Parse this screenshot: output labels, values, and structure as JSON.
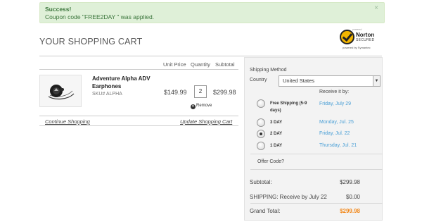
{
  "alert": {
    "heading": "Success!",
    "message": "Coupon code \"FREE2DAY \" was applied.",
    "close": "×",
    "color": "#dff0d8"
  },
  "cart": {
    "title": "YOUR SHOPPING CART",
    "headers": {
      "unit_price": "Unit Price",
      "quantity": "Quantity",
      "subtotal": "Subtotal"
    },
    "item": {
      "name": "Adventure Alpha ADV Earphones",
      "sku": "SKU# ALPHA",
      "unit_price": "$149.99",
      "quantity": "2",
      "remove": "Remove",
      "subtotal": "$299.98"
    },
    "continue_link": "Continue Shopping",
    "update_link": "Update Shopping Cart"
  },
  "badge": {
    "top_text": "powered",
    "name": "Norton",
    "secured": "SECURED",
    "powered_by": "powered by Symantec"
  },
  "panel": {
    "shipping_method_label": "Shipping Method",
    "country_label": "Country",
    "country_value": "United States",
    "receive_label": "Receive it by:",
    "options": [
      {
        "name": "Free Shipping (5-9 days)",
        "date": "Friday, July 29",
        "selected": false
      },
      {
        "name": "3 DAY",
        "date": "Monday, Jul. 25",
        "selected": false
      },
      {
        "name": "2 DAY",
        "date": "Friday, Jul. 22",
        "selected": true
      },
      {
        "name": "1 DAY",
        "date": "Thursday, Jul. 21",
        "selected": false
      }
    ],
    "offer_code": "Offer Code?",
    "subtotal_label": "Subtotal:",
    "subtotal_value": "$299.98",
    "shipping_label": "SHIPPING: Receive by July 22",
    "shipping_value": "$0.00",
    "grand_total_label": "Grand Total:",
    "grand_total_value": "$299.98",
    "grand_total_color": "#f28a1e",
    "date_color": "#4a9fd6"
  }
}
